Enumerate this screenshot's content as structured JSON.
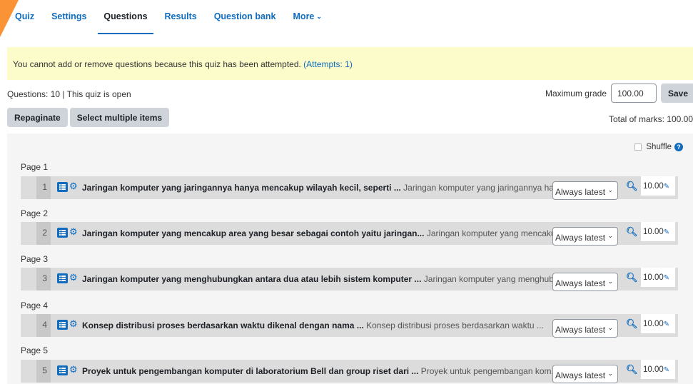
{
  "tabs": [
    {
      "label": "Quiz"
    },
    {
      "label": "Settings"
    },
    {
      "label": "Questions"
    },
    {
      "label": "Results"
    },
    {
      "label": "Question bank"
    },
    {
      "label": "More"
    }
  ],
  "notice": {
    "text": "You cannot add or remove questions because this quiz has been attempted.",
    "link": "(Attempts: 1)"
  },
  "info": {
    "summary": "Questions: 10 | This quiz is open",
    "max_grade_label": "Maximum grade",
    "max_grade_value": "100.00",
    "save_label": "Save",
    "total_marks": "Total of marks: 100.00"
  },
  "actions": {
    "repaginate": "Repaginate",
    "select_multiple": "Select multiple items"
  },
  "shuffle_label": "Shuffle",
  "slots": [
    {
      "page": "Page 1",
      "num": "1",
      "title": "Jaringan komputer yang jaringannya hanya mencakup wilayah kecil, seperti ...",
      "preview": "Jaringan komputer yang jaringannya han...",
      "version": "Always latest",
      "mark": "10.00"
    },
    {
      "page": "Page 2",
      "num": "2",
      "title": "Jaringan komputer yang mencakup area yang besar sebagai contoh yaitu jaringan...",
      "preview": "Jaringan komputer yang mencakup...",
      "version": "Always latest",
      "mark": "10.00"
    },
    {
      "page": "Page 3",
      "num": "3",
      "title": "Jaringan komputer yang menghubungkan antara dua atau lebih sistem komputer ...",
      "preview": "Jaringan komputer yang menghub...",
      "version": "Always latest",
      "mark": "10.00"
    },
    {
      "page": "Page 4",
      "num": "4",
      "title": "Konsep distribusi proses berdasarkan waktu dikenal dengan nama ...",
      "preview": "Konsep distribusi proses berdasarkan waktu ...",
      "version": "Always latest",
      "mark": "10.00"
    },
    {
      "page": "Page 5",
      "num": "5",
      "title": "Proyek untuk pengembangan komputer di laboratorium Bell dan group riset dari ...",
      "preview": "Proyek untuk pengembangan kom...",
      "version": "Always latest",
      "mark": "10.00"
    }
  ],
  "colors": {
    "accent": "#0f6cbf",
    "notice_bg": "#fcfccb",
    "brand": "#f98012"
  }
}
